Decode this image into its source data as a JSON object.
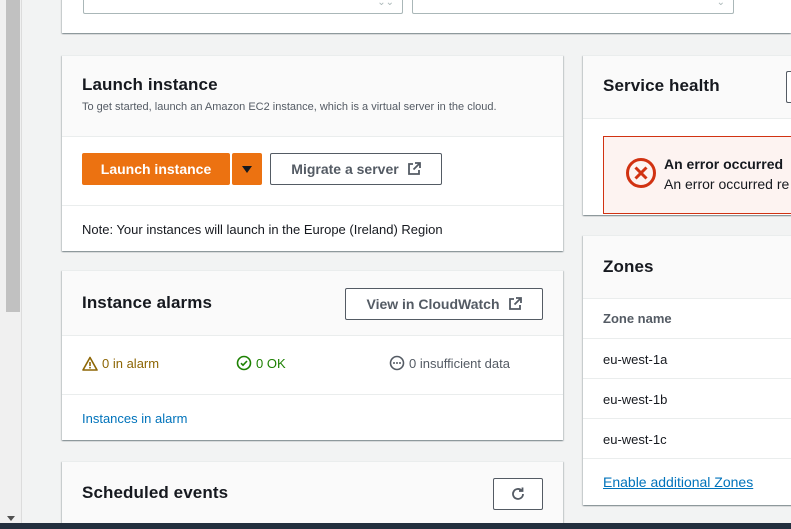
{
  "launch": {
    "title": "Launch instance",
    "description": "To get started, launch an Amazon EC2 instance, which is a virtual server in the cloud.",
    "primary_button": "Launch instance",
    "migrate_button": "Migrate a server",
    "note": "Note: Your instances will launch in the Europe (Ireland) Region"
  },
  "alarms": {
    "title": "Instance alarms",
    "cloudwatch_button": "View in CloudWatch",
    "in_alarm": "0 in alarm",
    "ok": "0 OK",
    "insufficient": "0 insufficient data",
    "link": "Instances in alarm"
  },
  "scheduled": {
    "title": "Scheduled events"
  },
  "health": {
    "title": "Service health",
    "error_title": "An error occurred",
    "error_text": "An error occurred re"
  },
  "zones": {
    "title": "Zones",
    "column_header": "Zone name",
    "rows": [
      "eu-west-1a",
      "eu-west-1b",
      "eu-west-1c"
    ],
    "link": "Enable additional Zones"
  },
  "colors": {
    "primary": "#ec7211",
    "link": "#0073bb",
    "error": "#d13212",
    "warning": "#8d6605",
    "success": "#1d8102"
  }
}
